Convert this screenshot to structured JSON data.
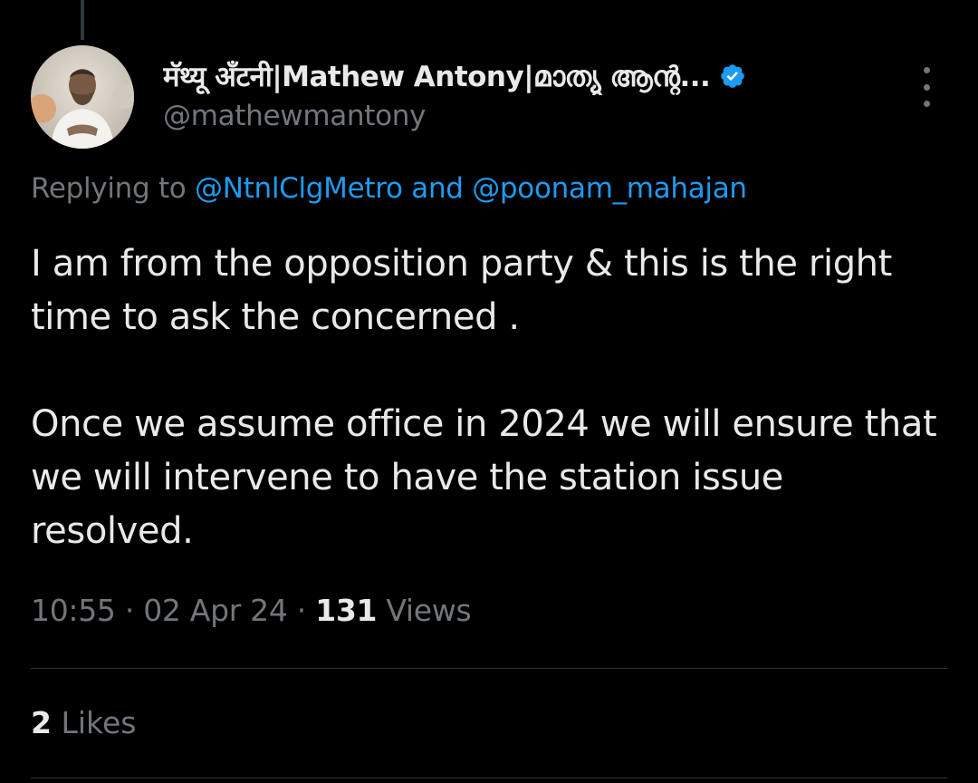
{
  "author": {
    "display_name": "मॅथ्यू अँटनी|Mathew Antony|മാത്യു ആന്റ...",
    "handle": "@mathewmantony",
    "verified": true,
    "verified_color": "#1d9bf0"
  },
  "reply": {
    "prefix": "Replying to",
    "mention_1": "@NtnlClgMetro",
    "conjunction": "and",
    "mention_2": "@poonam_mahajan"
  },
  "tweet": {
    "paragraph_1": "I am from the opposition party & this is the right time to ask the concerned .",
    "paragraph_2": "Once we assume office in 2024 we will ensure that we will intervene to have the station issue resolved."
  },
  "meta": {
    "time": "10:55",
    "separator": "·",
    "date": "02 Apr 24",
    "views_count": "131",
    "views_label": "Views"
  },
  "engagement": {
    "likes_count": "2",
    "likes_label": "Likes"
  },
  "colors": {
    "background": "#000000",
    "text_primary": "#e7e9ea",
    "text_secondary": "#71767b",
    "link": "#1d9bf0",
    "divider": "#2f3336"
  }
}
